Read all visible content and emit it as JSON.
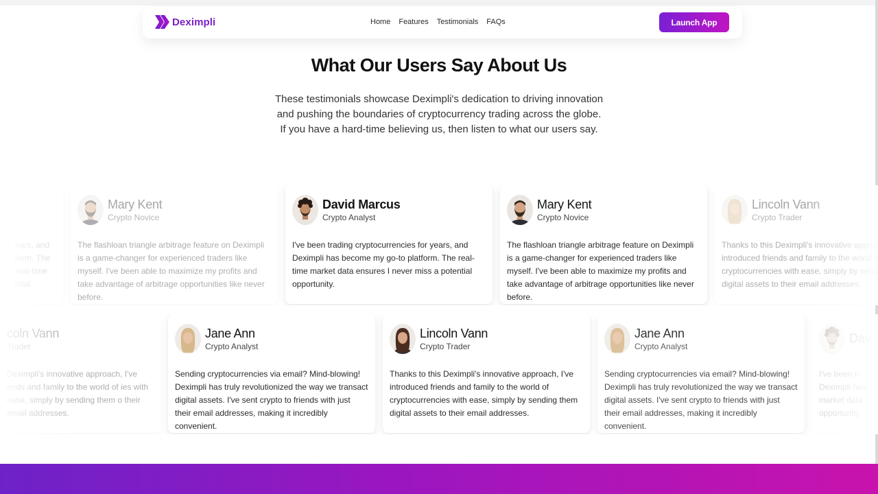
{
  "navbar": {
    "brand_name": "Deximpli",
    "links": [
      "Home",
      "Features",
      "Testimonials",
      "FAQs"
    ],
    "launch_label": "Launch App",
    "accent": "#7b1fc8"
  },
  "section": {
    "heading": "What Our Users Say About Us",
    "subtext": "These testimonials showcase Deximpli's dedication to driving innovation and pushing the boundaries of cryptocurrency trading across the globe. If you have a hard-time believing us, then listen to what our users say."
  },
  "row1": [
    {
      "name": "",
      "role": "",
      "quote": "ears, and form. The real-time ntial",
      "avatar": "avatar-man-curly-icon"
    },
    {
      "name": "Mary Kent",
      "role": "Crypto Novice",
      "quote": "The flashloan triangle arbitrage feature on Deximpli is a game-changer for experienced traders like myself. I've been able to maximize my profits and take advantage of arbitrage opportunities like never before.",
      "avatar": "avatar-man-beard-icon"
    },
    {
      "name": "David Marcus",
      "role": "Crypto Analyst",
      "quote": "I've been trading cryptocurrencies for years, and Deximpli has become my go-to platform. The real-time market data ensures I never miss a potential opportunity.",
      "avatar": "avatar-man-curly-icon"
    },
    {
      "name": "Mary Kent",
      "role": "Crypto Novice",
      "quote": "The flashloan triangle arbitrage feature on Deximpli is a game-changer for experienced traders like myself. I've been able to maximize my profits and take advantage of arbitrage opportunities like never before.",
      "avatar": "avatar-man-beard-icon"
    },
    {
      "name": "Lincoln Vann",
      "role": "Crypto Trader",
      "quote": "Thanks to this Deximpli's innovative approach, I've introduced friends and family to the world of cryptocurrencies with ease, simply by sending them digital assets to their email addresses.",
      "avatar": "avatar-woman-blonde-icon"
    }
  ],
  "row2": [
    {
      "name": "coln Vann",
      "role": "Trader",
      "quote": "Deximpli's innovative approach, I've ends and family to the world of ies with ease, simply by sending them o their email addresses.",
      "avatar": "avatar-woman-dark-icon"
    },
    {
      "name": "Jane Ann",
      "role": "Crypto Analyst",
      "quote": "Sending cryptocurrencies via email? Mind-blowing! Deximpli has truly revolutionized the way we transact digital assets. I've sent crypto to friends with just their email addresses, making it incredibly convenient.",
      "avatar": "avatar-woman-blonde-icon"
    },
    {
      "name": "Lincoln Vann",
      "role": "Crypto Trader",
      "quote": "Thanks to this Deximpli's innovative approach, I've introduced friends and family to the world of cryptocurrencies with ease, simply by sending them digital assets to their email addresses.",
      "avatar": "avatar-woman-dark-icon"
    },
    {
      "name": "Jane Ann",
      "role": "Crypto Analyst",
      "quote": "Sending cryptocurrencies via email? Mind-blowing! Deximpli has truly revolutionized the way we transact digital assets. I've sent crypto to friends with just their email addresses, making it incredibly convenient.",
      "avatar": "avatar-woman-blonde-icon"
    },
    {
      "name": "Dav",
      "role": "",
      "quote": "I've been tr Deximpli has market data opportunity",
      "avatar": "avatar-man-curly-icon"
    }
  ],
  "colors": {
    "brand_purple": "#7b1fc8",
    "button_gradient_start": "#7a1fd6",
    "button_gradient_end": "#c014c3",
    "footer_gradient_start": "#6d22c7",
    "footer_gradient_end": "#c813ad"
  }
}
